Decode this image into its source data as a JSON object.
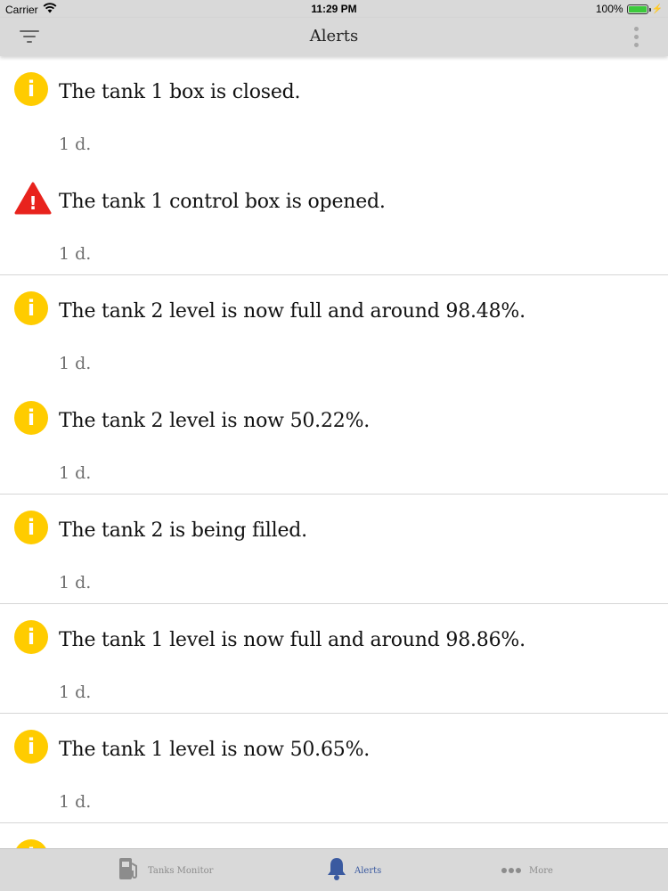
{
  "status_bar": {
    "carrier": "Carrier",
    "time": "11:29 PM",
    "battery": "100%"
  },
  "nav": {
    "title": "Alerts"
  },
  "alerts": [
    {
      "type": "info",
      "message": "The tank 1 box is closed.",
      "time": "1 d."
    },
    {
      "type": "warning",
      "message": "The tank 1 control box is opened.",
      "time": "1 d."
    },
    {
      "type": "info",
      "message": "The tank 2 level is now full and around 98.48%.",
      "time": "1 d."
    },
    {
      "type": "info",
      "message": "The tank 2 level is now 50.22%.",
      "time": "1 d."
    },
    {
      "type": "info",
      "message": "The tank 2 is being filled.",
      "time": "1 d."
    },
    {
      "type": "info",
      "message": "The tank 1 level is now full and around 98.86%.",
      "time": "1 d."
    },
    {
      "type": "info",
      "message": "The tank 1 level is now 50.65%.",
      "time": "1 d."
    }
  ],
  "icons": {
    "info_glyph": "i",
    "warning_glyph": "!"
  },
  "colors": {
    "info": "#ffcc00",
    "warning": "#e8231d",
    "tab_active": "#3a5aa0",
    "tab_inactive": "#8c8c8c"
  },
  "tab_bar": {
    "tanks_monitor": "Tanks Monitor",
    "alerts": "Alerts",
    "more": "More"
  }
}
